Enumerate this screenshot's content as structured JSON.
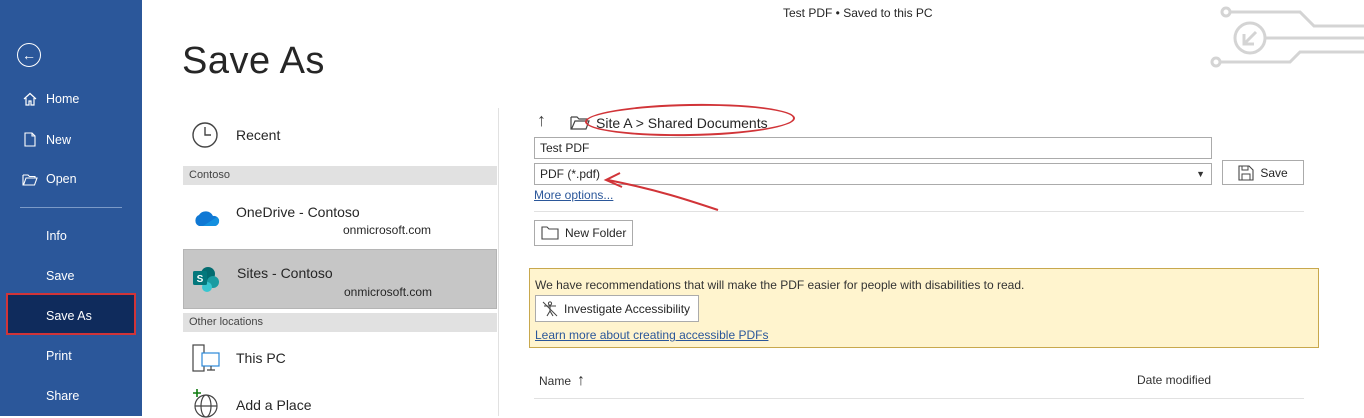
{
  "window": {
    "title": "Test PDF • Saved to this PC"
  },
  "nav": {
    "back_icon": "back-arrow-icon",
    "items": [
      {
        "label": "Home",
        "icon": "home-icon"
      },
      {
        "label": "New",
        "icon": "new-document-icon"
      },
      {
        "label": "Open",
        "icon": "open-folder-icon"
      }
    ],
    "plain_items": [
      "Info",
      "Save",
      "Save As",
      "Print",
      "Share"
    ],
    "selected": "Save As",
    "bg_color": "#2b579a",
    "selected_color": "#0f2b5c",
    "highlight_color": "#d13438"
  },
  "page": {
    "title": "Save As"
  },
  "locations": {
    "recent": "Recent",
    "contoso_header": "Contoso",
    "onedrive": {
      "name": "OneDrive - Contoso",
      "sub": "onmicrosoft.com"
    },
    "sites": {
      "name": "Sites - Contoso",
      "sub": "onmicrosoft.com"
    },
    "other_header": "Other locations",
    "this_pc": "This PC",
    "add_place": "Add a Place"
  },
  "save_panel": {
    "breadcrumb": "Site A > Shared Documents",
    "file_name": "Test PDF",
    "file_type": "PDF (*.pdf)",
    "save_label": "Save",
    "more_options": "More options...",
    "new_folder": "New Folder",
    "accessibility": {
      "message": "We have recommendations that will make the PDF easier for people with disabilities to read.",
      "button": "Investigate Accessibility",
      "link": "Learn more about creating accessible PDFs"
    },
    "columns": {
      "name": "Name",
      "sort_icon": "↑",
      "date": "Date modified"
    }
  }
}
